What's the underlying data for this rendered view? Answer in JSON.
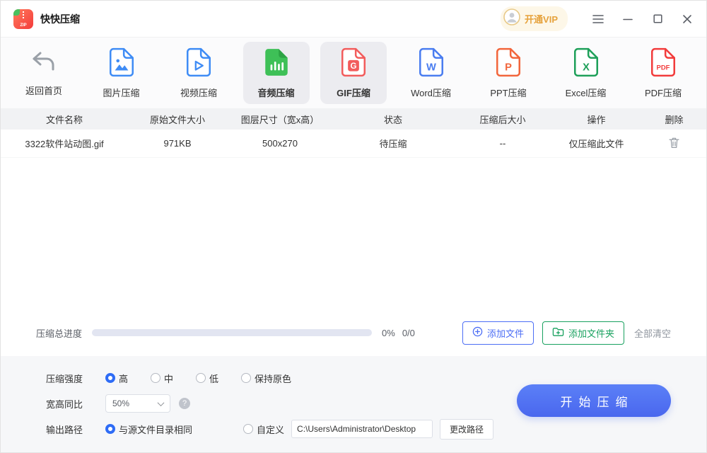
{
  "titlebar": {
    "app_title": "快快压缩",
    "logo_text": "ZIP",
    "vip_label": "开通VIP"
  },
  "toolbar": {
    "items": [
      {
        "label": "返回首页"
      },
      {
        "label": "图片压缩"
      },
      {
        "label": "视频压缩"
      },
      {
        "label": "音频压缩",
        "active": true
      },
      {
        "label": "GIF压缩",
        "active": true
      },
      {
        "label": "Word压缩"
      },
      {
        "label": "PPT压缩"
      },
      {
        "label": "Excel压缩"
      },
      {
        "label": "PDF压缩"
      }
    ]
  },
  "table": {
    "headers": [
      "文件名称",
      "原始文件大小",
      "图层尺寸（宽x高）",
      "状态",
      "压缩后大小",
      "操作",
      "删除"
    ],
    "rows": [
      {
        "name": "3322软件站动图.gif",
        "size": "971KB",
        "dimensions": "500x270",
        "status": "待压缩",
        "compressed_size": "--",
        "action": "仅压缩此文件"
      }
    ]
  },
  "progress": {
    "label": "压缩总进度",
    "percent": "0%",
    "count": "0/0",
    "add_file_label": "添加文件",
    "add_folder_label": "添加文件夹",
    "clear_all_label": "全部清空"
  },
  "settings": {
    "strength_label": "压缩强度",
    "strength_options": [
      "高",
      "中",
      "低",
      "保持原色"
    ],
    "strength_selected": "高",
    "ratio_label": "宽高同比",
    "ratio_value": "50%",
    "help_glyph": "?",
    "output_label": "输出路径",
    "output_same_label": "与源文件目录相同",
    "output_custom_label": "自定义",
    "output_path": "C:\\Users\\Administrator\\Desktop",
    "change_path_label": "更改路径",
    "start_label": "开始压缩"
  }
}
